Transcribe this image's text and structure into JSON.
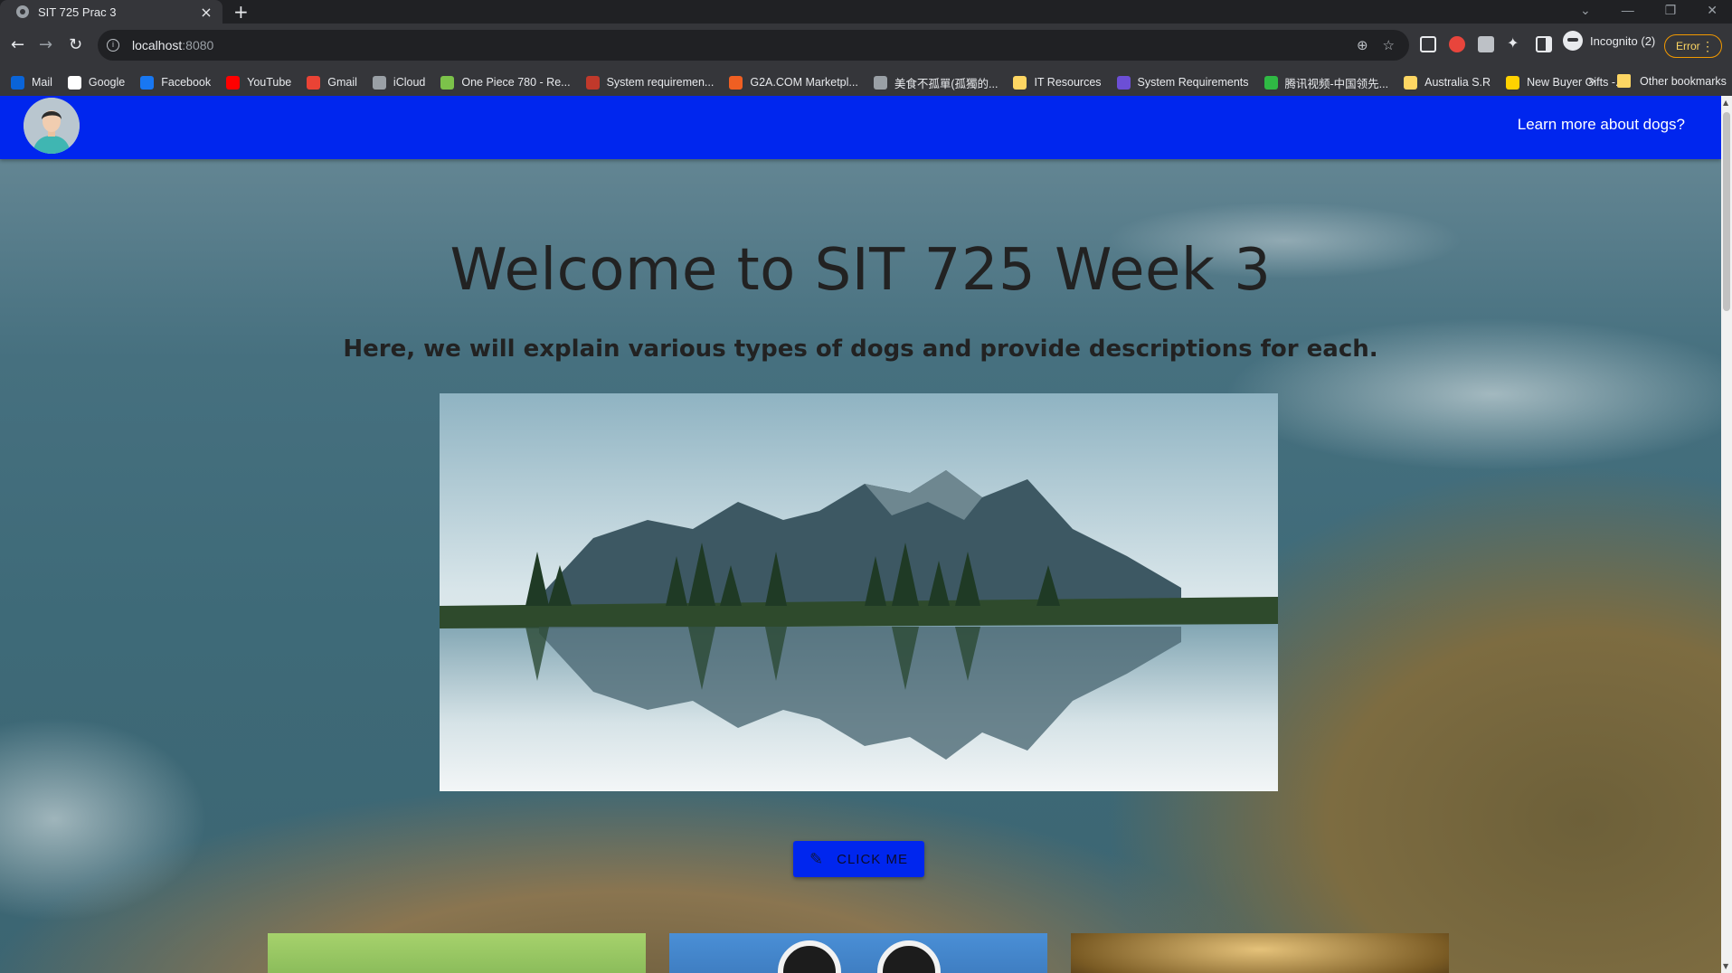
{
  "browser": {
    "tab_title": "SIT 725 Prac 3",
    "tab_close": "×",
    "new_tab": "+",
    "url_host": "localhost",
    "url_port": ":8080",
    "profile_label": "Incognito (2)",
    "error_label": "Error",
    "window_controls": [
      "⌄",
      "—",
      "❐",
      "✕"
    ]
  },
  "bookmarks": [
    {
      "label": "Mail",
      "color": "#0a64d8"
    },
    {
      "label": "Google",
      "color": "#ffffff"
    },
    {
      "label": "Facebook",
      "color": "#1877f2"
    },
    {
      "label": "YouTube",
      "color": "#ff0000"
    },
    {
      "label": "Gmail",
      "color": "#ea4335"
    },
    {
      "label": "iCloud",
      "color": "#9aa0a6"
    },
    {
      "label": "One Piece 780 - Re...",
      "color": "#7cc24a"
    },
    {
      "label": "System requiremen...",
      "color": "#c0392b"
    },
    {
      "label": "G2A.COM Marketpl...",
      "color": "#f05f22"
    },
    {
      "label": "美食不孤單(孤獨的...",
      "color": "#9aa0a6"
    },
    {
      "label": "IT Resources",
      "color": "#fdd663"
    },
    {
      "label": "System Requirements",
      "color": "#6c4fd6"
    },
    {
      "label": "腾讯视频-中国领先...",
      "color": "#2fb944"
    },
    {
      "label": "Australia S.R",
      "color": "#fdd663"
    },
    {
      "label": "New Buyer Gifts -...",
      "color": "#ffd200"
    }
  ],
  "bookmarks_more": "»",
  "bookmarks_other": "Other bookmarks",
  "page": {
    "nav_link": "Learn more about dogs?",
    "heading": "Welcome to SIT 725 Week 3",
    "subheading": "Here, we will explain various types of dogs and provide descriptions for each.",
    "button_label": "CLICK ME",
    "brand_color": "#0026ee"
  }
}
